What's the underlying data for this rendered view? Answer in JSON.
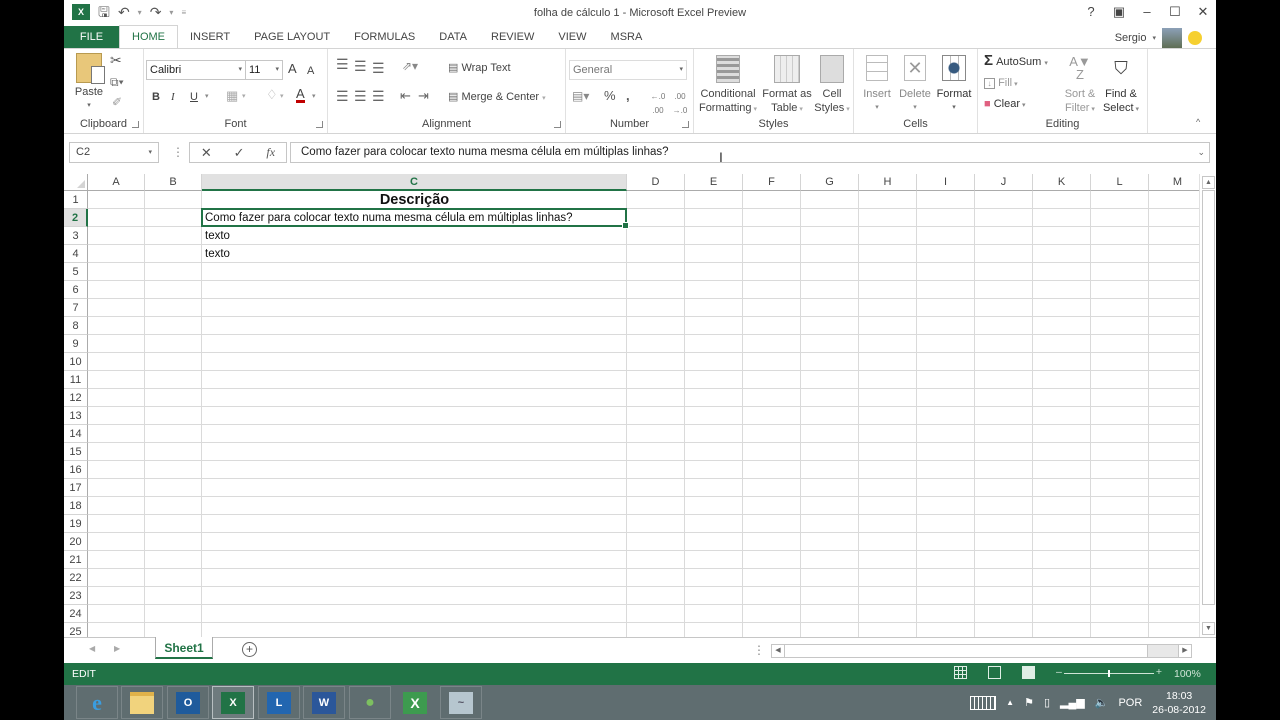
{
  "window": {
    "title": "folha de cálculo 1 - Microsoft Excel Preview",
    "controls": [
      "?",
      "restore-ribbon",
      "minimize",
      "maximize",
      "close"
    ]
  },
  "qat": {
    "app_icon": "X",
    "save": "save-icon",
    "undo": "undo-icon",
    "redo": "redo-icon",
    "customize": "customize-qat-icon"
  },
  "tabs": [
    {
      "label": "FILE"
    },
    {
      "label": "HOME"
    },
    {
      "label": "INSERT"
    },
    {
      "label": "PAGE LAYOUT"
    },
    {
      "label": "FORMULAS"
    },
    {
      "label": "DATA"
    },
    {
      "label": "REVIEW"
    },
    {
      "label": "VIEW"
    },
    {
      "label": "MSRA"
    }
  ],
  "active_tab": "HOME",
  "user": {
    "name": "Sergio"
  },
  "ribbon": {
    "clipboard": {
      "label": "Clipboard",
      "paste": "Paste"
    },
    "font": {
      "label": "Font",
      "font_name": "Calibri",
      "font_size": "11",
      "bold": "B",
      "italic": "I",
      "underline": "U",
      "grow": "A",
      "shrink": "A",
      "font_color": "A"
    },
    "alignment": {
      "label": "Alignment",
      "wrap_text": "Wrap Text",
      "merge_center": "Merge & Center"
    },
    "number": {
      "label": "Number",
      "format": "General",
      "percent": "%",
      "comma": ",",
      "inc_decimal": "←.0 .00",
      "dec_decimal": ".00 →.0"
    },
    "styles": {
      "label": "Styles",
      "conditional_1": "Conditional",
      "conditional_2": "Formatting",
      "format_table_1": "Format as",
      "format_table_2": "Table",
      "cell_styles_1": "Cell",
      "cell_styles_2": "Styles"
    },
    "cells": {
      "label": "Cells",
      "insert": "Insert",
      "delete": "Delete",
      "format": "Format"
    },
    "editing": {
      "label": "Editing",
      "autosum": "AutoSum",
      "fill": "Fill",
      "clear": "Clear",
      "sort_1": "Sort &",
      "sort_2": "Filter",
      "find_1": "Find &",
      "find_2": "Select"
    }
  },
  "formula_bar": {
    "name_box": "C2",
    "cancel": "✕",
    "enter": "✓",
    "fx": "fx",
    "value": "Como fazer para colocar texto numa mesma célula em múltiplas linhas?"
  },
  "sheet": {
    "columns": [
      "A",
      "B",
      "C",
      "D",
      "E",
      "F",
      "G",
      "H",
      "I",
      "J",
      "K",
      "L",
      "M"
    ],
    "selected_column": "C",
    "rows": [
      "1",
      "2",
      "3",
      "4",
      "5",
      "6",
      "7",
      "8",
      "9",
      "10",
      "11",
      "12",
      "13",
      "14",
      "15",
      "16",
      "17",
      "18",
      "19",
      "20",
      "21",
      "22",
      "23",
      "24",
      "25"
    ],
    "selected_row": "2",
    "active_cell": "C2",
    "cells": {
      "C1": "Descrição",
      "C2": "Como fazer para colocar texto numa mesma célula em múltiplas linhas?",
      "C3": "texto",
      "C4": "texto"
    }
  },
  "sheet_tabs": {
    "tabs": [
      "Sheet1"
    ],
    "active": "Sheet1",
    "add": "+"
  },
  "status_bar": {
    "mode": "EDIT",
    "zoom": "100%",
    "zoom_level_percent": 100
  },
  "taskbar": {
    "apps": [
      {
        "name": "internet-explorer"
      },
      {
        "name": "file-explorer"
      },
      {
        "name": "outlook"
      },
      {
        "name": "excel",
        "active": true
      },
      {
        "name": "lync"
      },
      {
        "name": "word"
      },
      {
        "name": "people-app"
      },
      {
        "name": "excel-file"
      },
      {
        "name": "performance-monitor"
      }
    ],
    "tray": {
      "language": "POR",
      "time": "18:03",
      "date": "26-08-2012"
    }
  }
}
